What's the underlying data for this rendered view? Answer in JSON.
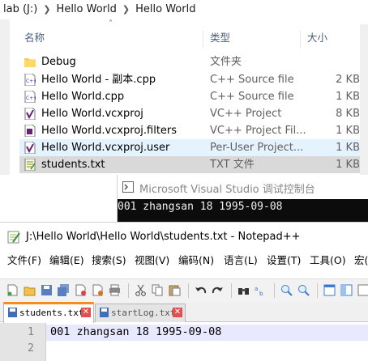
{
  "explorer": {
    "breadcrumb": [
      "lab (J:)",
      "Hello World",
      "Hello World"
    ],
    "columns": {
      "name": "名称",
      "type": "类型",
      "size": "大小"
    },
    "files": [
      {
        "name": "Debug",
        "type": "文件夹",
        "size": "",
        "icon": "folder-icon"
      },
      {
        "name": "Hello World - 副本.cpp",
        "type": "C++ Source file",
        "size": "2 KB",
        "icon": "cpp-file-icon"
      },
      {
        "name": "Hello World.cpp",
        "type": "C++ Source file",
        "size": "1 KB",
        "icon": "cpp-file-icon"
      },
      {
        "name": "Hello World.vcxproj",
        "type": "VC++ Project",
        "size": "8 KB",
        "icon": "vcxproj-file-icon"
      },
      {
        "name": "Hello World.vcxproj.filters",
        "type": "VC++ Project Fil...",
        "size": "1 KB",
        "icon": "filters-file-icon"
      },
      {
        "name": "Hello World.vcxproj.user",
        "type": "Per-User Project...",
        "size": "1 KB",
        "icon": "user-file-icon"
      },
      {
        "name": "students.txt",
        "type": "TXT 文件",
        "size": "1 KB",
        "icon": "txt-file-icon"
      }
    ]
  },
  "console": {
    "title": "Microsoft Visual Studio 调试控制台",
    "output": "001 zhangsan 18 1995-09-08"
  },
  "notepad": {
    "title": "J:\\Hello World\\Hello World\\students.txt - Notepad++",
    "menu": [
      "文件(F)",
      "编辑(E)",
      "搜索(S)",
      "视图(V)",
      "编码(N)",
      "语言(L)",
      "设置(T)",
      "工具(O)",
      "宏("
    ],
    "tabs": [
      {
        "label": "students.txt",
        "active": true
      },
      {
        "label": "startLog.txt",
        "active": false
      }
    ],
    "line_numbers": [
      "1",
      "2"
    ],
    "lines": [
      "001 zhangsan 18 1995-09-08",
      ""
    ]
  },
  "colors": {
    "selected_row": "#d9d9d9",
    "hover_row": "#e5f3ff",
    "active_tab_accent": "#fa8a1f",
    "console_bg": "#0c0c0c",
    "current_line": "#e8e8ff"
  }
}
